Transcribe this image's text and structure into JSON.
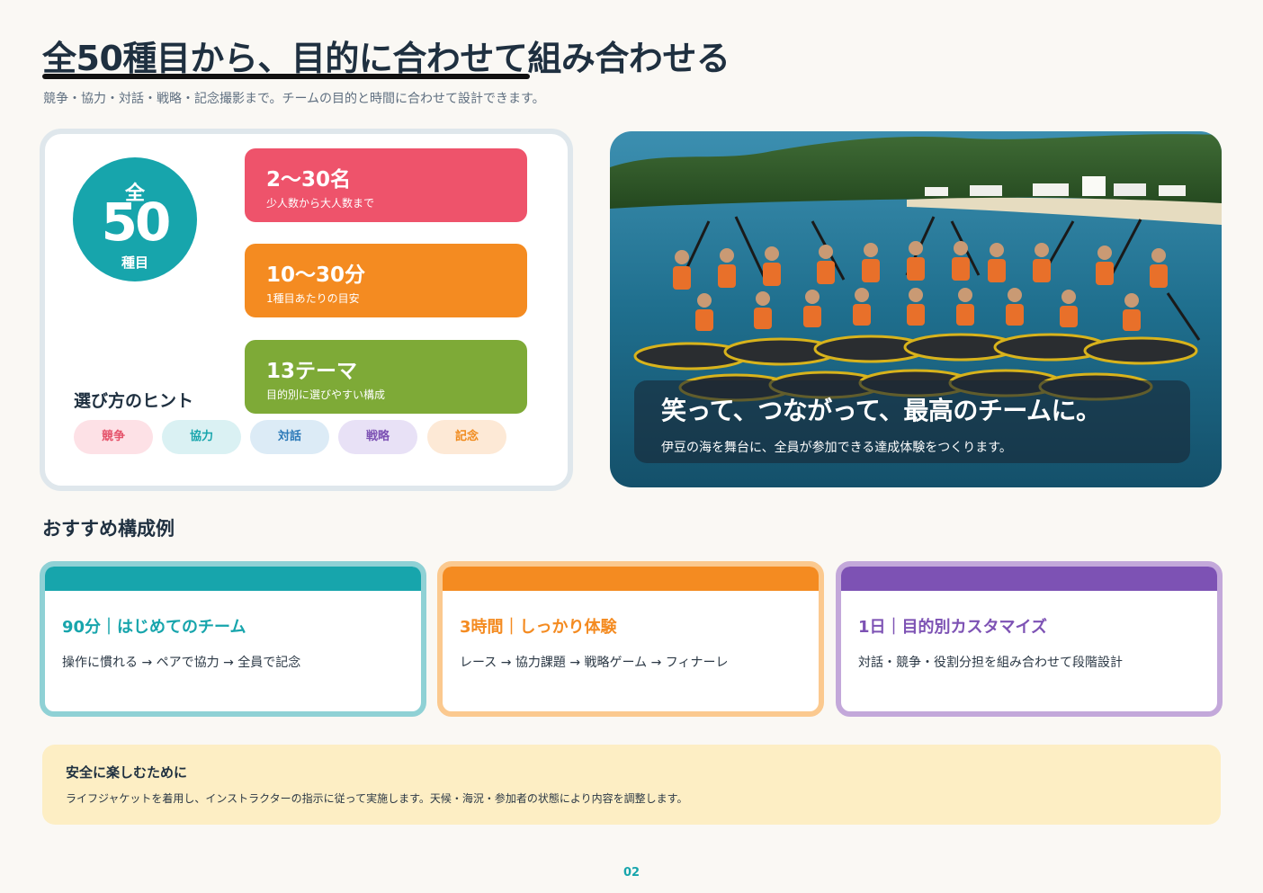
{
  "header": {
    "title": "全50種目から、目的に合わせて組み合わせる",
    "subtitle": "競争・協力・対話・戦略・記念撮影まで。チームの目的と時間に合わせて設計できます。"
  },
  "badge": {
    "top": "全",
    "number": "50",
    "bottom": "種目"
  },
  "stats": [
    {
      "main": "2〜30名",
      "sub": "少人数から大人数まで"
    },
    {
      "main": "10〜30分",
      "sub": "1種目あたりの目安"
    },
    {
      "main": "13テーマ",
      "sub": "目的別に選びやすい構成"
    }
  ],
  "hints": {
    "title": "選び方のヒント",
    "tags": [
      "競争",
      "協力",
      "対話",
      "戦略",
      "記念"
    ]
  },
  "photo": {
    "headline": "笑って、つながって、最高のチームに。",
    "caption": "伊豆の海を舞台に、全員が参加できる達成体験をつくります。"
  },
  "section": {
    "title": "おすすめ構成例"
  },
  "plans": [
    {
      "title": "90分｜はじめてのチーム",
      "desc": "操作に慣れる → ペアで協力 → 全員で記念",
      "color": "#17a5ac"
    },
    {
      "title": "3時間｜しっかり体験",
      "desc": "レース → 協力課題 → 戦略ゲーム → フィナーレ",
      "color": "#f48b21"
    },
    {
      "title": "1日｜目的別カスタマイズ",
      "desc": "対話・競争・役割分担を組み合わせて段階設計",
      "color": "#7d52b4"
    }
  ],
  "safety": {
    "title": "安全に楽しむために",
    "body": "ライフジャケットを着用し、インストラクターの指示に従って実施します。天候・海況・参加者の状態により内容を調整します。"
  },
  "page": {
    "number": "02"
  },
  "colors": {
    "teal": "#17a5ac",
    "pink": "#ee536b",
    "orange": "#f48b21",
    "green": "#7eaa37",
    "purple": "#7d52b4",
    "safety_bg": "#fdeec4"
  }
}
